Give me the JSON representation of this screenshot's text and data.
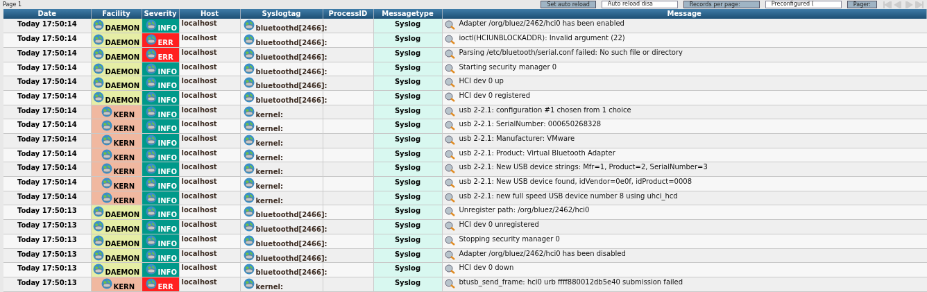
{
  "toolbar": {
    "page_label": "Page 1",
    "buttons": [
      "Set auto reload",
      "Records per page:",
      "Pager:"
    ],
    "selects": [
      "Auto reload disa",
      "Preconfigured ("
    ]
  },
  "table": {
    "columns": [
      "Date",
      "Facility",
      "Severity",
      "Host",
      "Syslogtag",
      "ProcessID",
      "Messagetype",
      "Message"
    ],
    "rows": [
      {
        "date": "Today 17:50:14",
        "facility": {
          "label": "DAEMON",
          "color": "#e6eea6"
        },
        "severity": {
          "label": "INFO",
          "color": "#00998a"
        },
        "host": "localhost",
        "tag": "bluetoothd[2466]:",
        "type": "Syslog",
        "message": "Adapter /org/bluez/2462/hci0 has been enabled"
      },
      {
        "date": "Today 17:50:14",
        "facility": {
          "label": "DAEMON",
          "color": "#e6eea6"
        },
        "severity": {
          "label": "ERR",
          "color": "#ff2020"
        },
        "host": "localhost",
        "tag": "bluetoothd[2466]:",
        "type": "Syslog",
        "message": "ioctl(HCIUNBLOCKADDR): Invalid argument (22)"
      },
      {
        "date": "Today 17:50:14",
        "facility": {
          "label": "DAEMON",
          "color": "#e6eea6"
        },
        "severity": {
          "label": "ERR",
          "color": "#ff2020"
        },
        "host": "localhost",
        "tag": "bluetoothd[2466]:",
        "type": "Syslog",
        "message": "Parsing /etc/bluetooth/serial.conf failed: No such file or directory"
      },
      {
        "date": "Today 17:50:14",
        "facility": {
          "label": "DAEMON",
          "color": "#e6eea6"
        },
        "severity": {
          "label": "INFO",
          "color": "#00998a"
        },
        "host": "localhost",
        "tag": "bluetoothd[2466]:",
        "type": "Syslog",
        "message": "Starting security manager 0"
      },
      {
        "date": "Today 17:50:14",
        "facility": {
          "label": "DAEMON",
          "color": "#e6eea6"
        },
        "severity": {
          "label": "INFO",
          "color": "#00998a"
        },
        "host": "localhost",
        "tag": "bluetoothd[2466]:",
        "type": "Syslog",
        "message": "HCI dev 0 up"
      },
      {
        "date": "Today 17:50:14",
        "facility": {
          "label": "DAEMON",
          "color": "#e6eea6"
        },
        "severity": {
          "label": "INFO",
          "color": "#00998a"
        },
        "host": "localhost",
        "tag": "bluetoothd[2466]:",
        "type": "Syslog",
        "message": "HCI dev 0 registered"
      },
      {
        "date": "Today 17:50:14",
        "facility": {
          "label": "KERN",
          "color": "#f0b8a0"
        },
        "severity": {
          "label": "INFO",
          "color": "#00998a"
        },
        "host": "localhost",
        "tag": "kernel:",
        "type": "Syslog",
        "message": "usb 2-2.1: configuration #1 chosen from 1 choice"
      },
      {
        "date": "Today 17:50:14",
        "facility": {
          "label": "KERN",
          "color": "#f0b8a0"
        },
        "severity": {
          "label": "INFO",
          "color": "#00998a"
        },
        "host": "localhost",
        "tag": "kernel:",
        "type": "Syslog",
        "message": "usb 2-2.1: SerialNumber: 000650268328"
      },
      {
        "date": "Today 17:50:14",
        "facility": {
          "label": "KERN",
          "color": "#f0b8a0"
        },
        "severity": {
          "label": "INFO",
          "color": "#00998a"
        },
        "host": "localhost",
        "tag": "kernel:",
        "type": "Syslog",
        "message": "usb 2-2.1: Manufacturer: VMware"
      },
      {
        "date": "Today 17:50:14",
        "facility": {
          "label": "KERN",
          "color": "#f0b8a0"
        },
        "severity": {
          "label": "INFO",
          "color": "#00998a"
        },
        "host": "localhost",
        "tag": "kernel:",
        "type": "Syslog",
        "message": "usb 2-2.1: Product: Virtual Bluetooth Adapter"
      },
      {
        "date": "Today 17:50:14",
        "facility": {
          "label": "KERN",
          "color": "#f0b8a0"
        },
        "severity": {
          "label": "INFO",
          "color": "#00998a"
        },
        "host": "localhost",
        "tag": "kernel:",
        "type": "Syslog",
        "message": "usb 2-2.1: New USB device strings: Mfr=1, Product=2, SerialNumber=3"
      },
      {
        "date": "Today 17:50:14",
        "facility": {
          "label": "KERN",
          "color": "#f0b8a0"
        },
        "severity": {
          "label": "INFO",
          "color": "#00998a"
        },
        "host": "localhost",
        "tag": "kernel:",
        "type": "Syslog",
        "message": "usb 2-2.1: New USB device found, idVendor=0e0f, idProduct=0008"
      },
      {
        "date": "Today 17:50:14",
        "facility": {
          "label": "KERN",
          "color": "#f0b8a0"
        },
        "severity": {
          "label": "INFO",
          "color": "#00998a"
        },
        "host": "localhost",
        "tag": "kernel:",
        "type": "Syslog",
        "message": "usb 2-2.1: new full speed USB device number 8 using uhci_hcd"
      },
      {
        "date": "Today 17:50:13",
        "facility": {
          "label": "DAEMON",
          "color": "#e6eea6"
        },
        "severity": {
          "label": "INFO",
          "color": "#00998a"
        },
        "host": "localhost",
        "tag": "bluetoothd[2466]:",
        "type": "Syslog",
        "message": "Unregister path: /org/bluez/2462/hci0"
      },
      {
        "date": "Today 17:50:13",
        "facility": {
          "label": "DAEMON",
          "color": "#e6eea6"
        },
        "severity": {
          "label": "INFO",
          "color": "#00998a"
        },
        "host": "localhost",
        "tag": "bluetoothd[2466]:",
        "type": "Syslog",
        "message": "HCI dev 0 unregistered"
      },
      {
        "date": "Today 17:50:13",
        "facility": {
          "label": "DAEMON",
          "color": "#e6eea6"
        },
        "severity": {
          "label": "INFO",
          "color": "#00998a"
        },
        "host": "localhost",
        "tag": "bluetoothd[2466]:",
        "type": "Syslog",
        "message": "Stopping security manager 0"
      },
      {
        "date": "Today 17:50:13",
        "facility": {
          "label": "DAEMON",
          "color": "#e6eea6"
        },
        "severity": {
          "label": "INFO",
          "color": "#00998a"
        },
        "host": "localhost",
        "tag": "bluetoothd[2466]:",
        "type": "Syslog",
        "message": "Adapter /org/bluez/2462/hci0 has been disabled"
      },
      {
        "date": "Today 17:50:13",
        "facility": {
          "label": "DAEMON",
          "color": "#e6eea6"
        },
        "severity": {
          "label": "INFO",
          "color": "#00998a"
        },
        "host": "localhost",
        "tag": "bluetoothd[2466]:",
        "type": "Syslog",
        "message": "HCI dev 0 down"
      },
      {
        "date": "Today 17:50:13",
        "facility": {
          "label": "KERN",
          "color": "#f0b8a0"
        },
        "severity": {
          "label": "ERR",
          "color": "#ff2020"
        },
        "host": "localhost",
        "tag": "kernel:",
        "type": "Syslog",
        "message": "btusb_send_frame: hci0 urb ffff880012db5e40 submission failed"
      }
    ]
  }
}
